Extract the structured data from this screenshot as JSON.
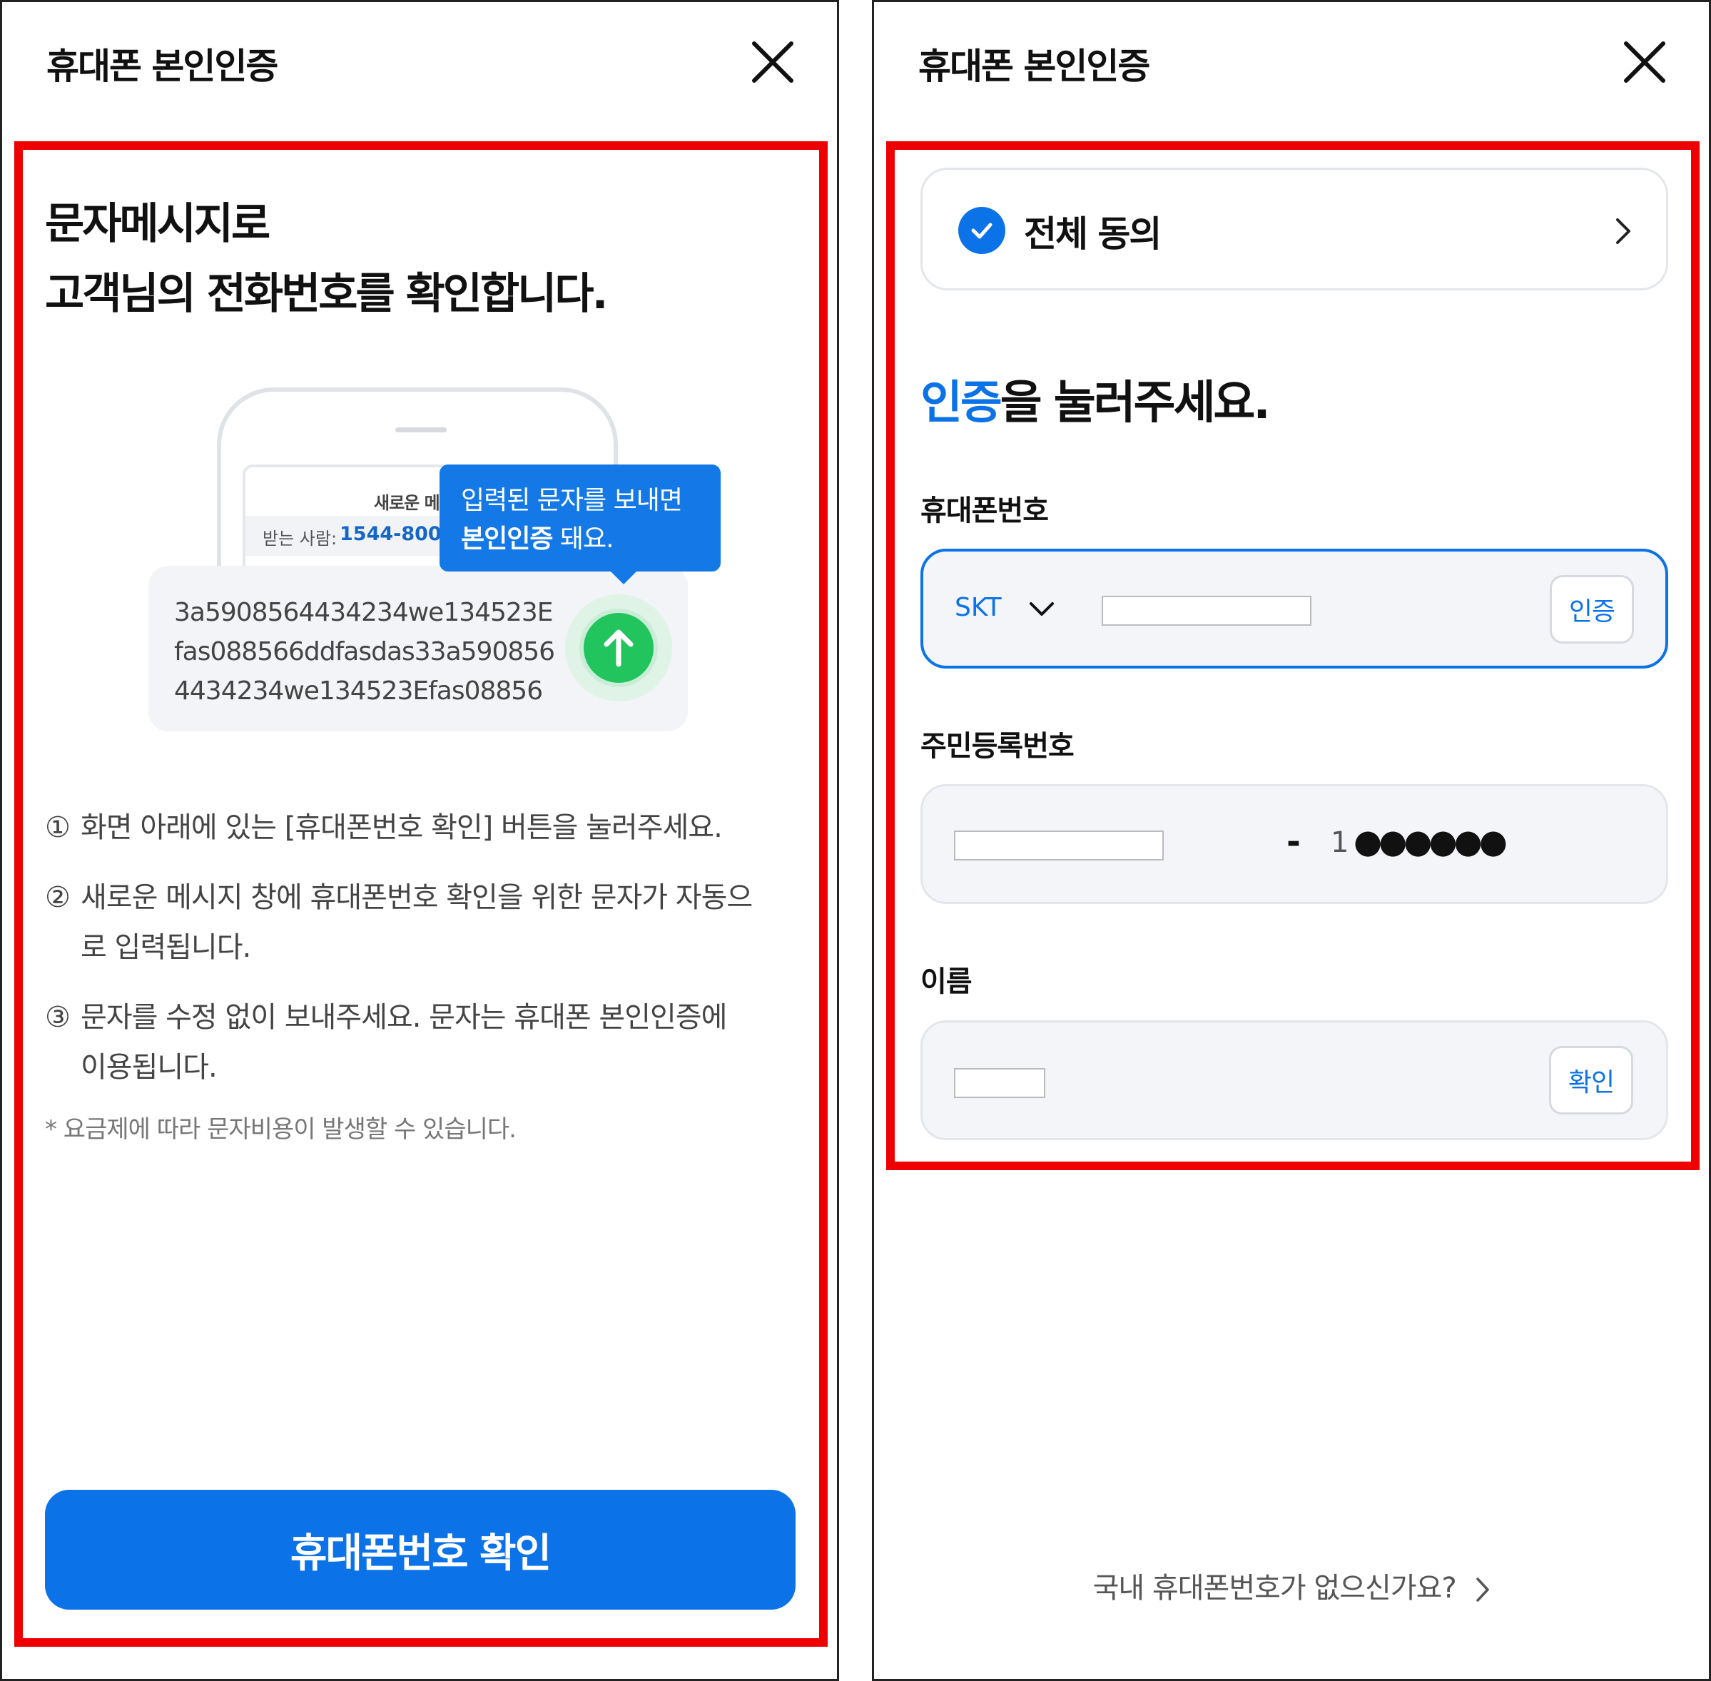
{
  "left_screen": {
    "header": {
      "title": "휴대폰 본인인증"
    },
    "heading": {
      "line1": "문자메시지로",
      "line2": "고객님의 전화번호를 확인합니다."
    },
    "illustration": {
      "message_header": "새로운 메시",
      "recipient_label": "받는 사람:",
      "recipient_number": "1544-8000",
      "tooltip": {
        "line1": "입력된 문자를 보내면",
        "line2_bold": "본인인증",
        "line2_rest": " 돼요."
      },
      "message_text": "3a5908564434234we134523Efas088566ddfasdas33a5908564434234we134523Efas08856"
    },
    "steps": [
      {
        "num": "①",
        "text": "화면 아래에 있는 [휴대폰번호 확인] 버튼을 눌러주세요.",
        "cont": ""
      },
      {
        "num": "②",
        "text": "새로운 메시지 창에 휴대폰번호 확인을 위한 문자가 자동으",
        "cont": "로 입력됩니다."
      },
      {
        "num": "③",
        "text": "문자를 수정 없이 보내주세요. 문자는 휴대폰 본인인증에",
        "cont": "이용됩니다."
      }
    ],
    "footnote": "* 요금제에 따라 문자비용이 발생할 수 있습니다.",
    "primary_button": "휴대폰번호 확인"
  },
  "right_screen": {
    "header": {
      "title": "휴대폰 본인인증"
    },
    "agree_all": {
      "label": "전체 동의",
      "checked": true
    },
    "prompt": {
      "accent": "인증",
      "rest": "을 눌러주세요."
    },
    "phone_field": {
      "label": "휴대폰번호",
      "carrier": "SKT",
      "value": "",
      "button": "인증"
    },
    "rrn_field": {
      "label": "주민등록번호",
      "value": "",
      "dash": "-",
      "gender_digit": "1",
      "masked": "●●●●●●"
    },
    "name_field": {
      "label": "이름",
      "value": "",
      "button": "확인"
    },
    "no_phone_link": "국내 휴대폰번호가 없으신가요?"
  },
  "colors": {
    "accent": "#0b72e7",
    "highlight_border": "#ee0000",
    "send_button": "#22c45e"
  },
  "icons": [
    "close-icon",
    "send-arrow-icon",
    "check-icon",
    "chevron-right-icon",
    "chevron-down-icon"
  ]
}
